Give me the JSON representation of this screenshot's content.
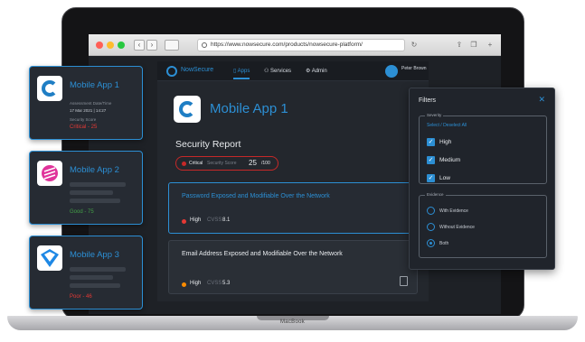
{
  "device": {
    "brand": "MacBook"
  },
  "browser": {
    "url": "https://www.nowsecure.com/products/nowsecure-platform/",
    "nav": {
      "back": "‹",
      "forward": "›"
    }
  },
  "app": {
    "brand": "NowSecure",
    "nav": [
      {
        "label": "Apps",
        "icon": "phone-icon",
        "active": true
      },
      {
        "label": "Services",
        "icon": "people-icon",
        "active": false
      },
      {
        "label": "Admin",
        "icon": "gear-icon",
        "active": false
      }
    ],
    "user": {
      "name": "Peter Brown"
    },
    "detail": {
      "app_name": "Mobile App 1",
      "section_title": "Security Report",
      "score": {
        "level": "Critical",
        "label": "Security Score",
        "value": "25",
        "max": "/100"
      },
      "findings": [
        {
          "title": "Password Exposed and Modifiable Over the Network",
          "severity": "High",
          "cvss_label": "CVSS",
          "cvss": "8.1",
          "color": "#e53935"
        },
        {
          "title": "Email Address Exposed and Modifiable Over the Network",
          "severity": "High",
          "cvss_label": "CVSS",
          "cvss": "5.3",
          "color": "#fb8c00"
        }
      ]
    }
  },
  "cards": [
    {
      "title": "Mobile App 1",
      "assessed_label": "Assessment Date/Time",
      "assessed": "17 Mar 2021 | 14:27",
      "score_label": "Security Score",
      "score": "Critical - 25",
      "score_color": "#e53935"
    },
    {
      "title": "Mobile App 2",
      "score": "Good - 75",
      "score_color": "#43a047"
    },
    {
      "title": "Mobile App 3",
      "score": "Poor - 46",
      "score_color": "#e53935"
    }
  ],
  "filters": {
    "title": "Filters",
    "close": "✕",
    "severity": {
      "legend": "Severity",
      "select_all": "Select / Deselect All",
      "options": [
        {
          "label": "High",
          "checked": true
        },
        {
          "label": "Medium",
          "checked": true
        },
        {
          "label": "Low",
          "checked": true
        }
      ]
    },
    "evidence": {
      "legend": "Evidence",
      "options": [
        {
          "label": "With Evidence",
          "selected": false
        },
        {
          "label": "Without Evidence",
          "selected": false
        },
        {
          "label": "Both",
          "selected": true
        }
      ]
    }
  },
  "colors": {
    "accent": "#2c8fd4",
    "critical": "#e53935",
    "good": "#43a047",
    "panel": "#23272d"
  }
}
